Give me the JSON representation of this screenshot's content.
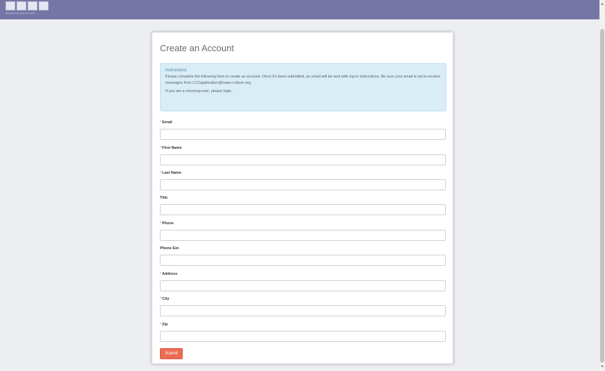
{
  "header": {
    "logo_text": "Massachusetts Cultural Council",
    "brand_color": "#7676a6"
  },
  "form": {
    "title": "Create an Account",
    "instructions": {
      "heading": "Instructions",
      "text": "Please complete the following form to create an account. Once it's been submitted, an email will be sent with log-in instructions. Be sure your email is set to receive messages from LCCapplication@mass-culture.org.",
      "returning_text": "If you are a returning user, please login."
    },
    "fields": [
      {
        "label": "Email",
        "required": true,
        "value": ""
      },
      {
        "label": "First Name",
        "required": true,
        "value": ""
      },
      {
        "label": "Last Name",
        "required": true,
        "value": ""
      },
      {
        "label": "Title",
        "required": false,
        "value": ""
      },
      {
        "label": "Phone",
        "required": true,
        "value": ""
      },
      {
        "label": "Phone Ext.",
        "required": false,
        "value": ""
      },
      {
        "label": "Address",
        "required": true,
        "value": ""
      },
      {
        "label": "City",
        "required": true,
        "value": ""
      },
      {
        "label": "Zip",
        "required": true,
        "value": ""
      }
    ],
    "required_marker": "*",
    "submit_label": "Submit",
    "submit_color": "#ec6b52"
  }
}
